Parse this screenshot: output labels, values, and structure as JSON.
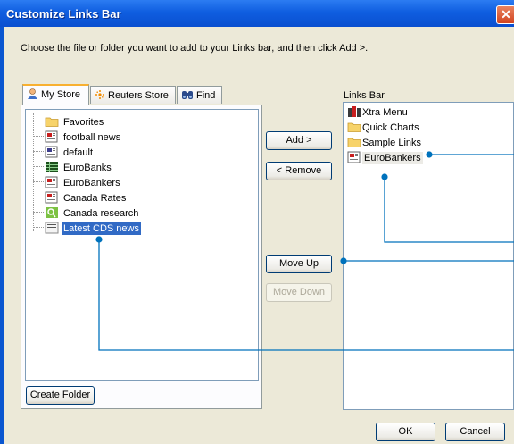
{
  "window": {
    "title": "Customize Links Bar",
    "close_glyph": "✕"
  },
  "instruction": "Choose the file or folder you want to add to your Links bar, and then click Add >.",
  "tabs": [
    {
      "label": "My Store",
      "icon": "person-icon",
      "active": true
    },
    {
      "label": "Reuters Store",
      "icon": "reuters-icon",
      "active": false
    },
    {
      "label": "Find",
      "icon": "binoculars-icon",
      "active": false
    }
  ],
  "tree_items": [
    {
      "label": "Favorites",
      "icon": "folder-icon"
    },
    {
      "label": "football news",
      "icon": "news-icon"
    },
    {
      "label": "default",
      "icon": "news-icon"
    },
    {
      "label": "EuroBanks",
      "icon": "quote-list-icon"
    },
    {
      "label": "EuroBankers",
      "icon": "news-icon"
    },
    {
      "label": "Canada Rates",
      "icon": "news-icon"
    },
    {
      "label": "Canada research",
      "icon": "research-icon"
    },
    {
      "label": "Latest CDS news",
      "icon": "headline-icon",
      "selected": true
    }
  ],
  "buttons": {
    "create_folder": "Create Folder",
    "add": "Add >",
    "remove": "< Remove",
    "move_up": "Move Up",
    "move_down": "Move Down",
    "ok": "OK",
    "cancel": "Cancel"
  },
  "links_bar": {
    "label": "Links Bar",
    "items": [
      {
        "label": "Xtra Menu",
        "icon": "menu-icon"
      },
      {
        "label": "Quick Charts",
        "icon": "folder-icon"
      },
      {
        "label": "Sample Links",
        "icon": "folder-icon"
      },
      {
        "label": "EuroBankers",
        "icon": "news-icon",
        "highlighted": true
      }
    ]
  },
  "colors": {
    "callout": "#0072bc",
    "selection": "#316ac5",
    "titlebar": "#0a56d0"
  }
}
